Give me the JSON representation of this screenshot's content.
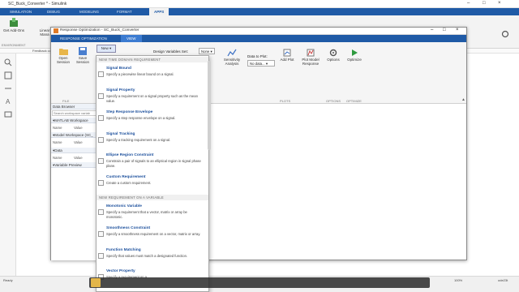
{
  "bg_window": {
    "title": "SC_Buck_Converter * - Simulink",
    "tabs": [
      "SIMULATION",
      "DEBUG",
      "MODELING",
      "FORMAT",
      "APPS"
    ],
    "active_tab": "APPS",
    "ribbon": {
      "get_addons": "Get Add-Ons",
      "linear_label": "Linear Mana",
      "environment": "ENVIRONMENT"
    },
    "address": "Feedback con"
  },
  "dialog": {
    "title": "Response Optimization - SC_Buck_Converter",
    "tabs": [
      "RESPONSE OPTIMIZATION",
      "VIEW"
    ],
    "active_tab": "VIEW",
    "ribbon": {
      "open_label": "Open Session",
      "save_label": "Save Session",
      "new_label": "New",
      "file_section": "FILE",
      "design_vars_label": "Design Variables Set:",
      "design_vars_value": "None",
      "sensitivity_label": "Sensitivity Analysis",
      "data_to_plot_label": "Data to Plot:",
      "data_to_plot_value": "No data...",
      "add_plot_label": "Add Plot",
      "plot_model_response_label": "Plot Model Response",
      "plots_section": "PLOTS",
      "options_label": "Options",
      "options_section": "OPTIONS",
      "optimize_label": "Optimize",
      "optimize_section": "OPTIMIZE"
    },
    "left_pane": {
      "data_browser": "Data Browser",
      "search_placeholder": "Search workspace variab",
      "matlab_workspace": "MATLAB Workspace",
      "model_workspace": "Model Workspace (SC_",
      "data": "Data",
      "variable_preview": "Variable Preview",
      "col_name": "Name",
      "col_value": "Value"
    }
  },
  "dropdown": {
    "section_time": "NEW TIME DOMAIN REQUIREMENT",
    "section_vars": "NEW REQUIREMENT ON A VARIABLE",
    "items_time": [
      {
        "title": "Signal Bound",
        "desc": "Specify a piecewise linear bound on a signal."
      },
      {
        "title": "Signal Property",
        "desc": "Specify a requirement on a signal property such as the mean value."
      },
      {
        "title": "Step Response Envelope",
        "desc": "Specify a step response envelope on a signal."
      },
      {
        "title": "Signal Tracking",
        "desc": "Specify a tracking requirement on a signal."
      },
      {
        "title": "Ellipse Region Constraint",
        "desc": "Constrain a pair of signals to an elliptical region in signal phase plane."
      },
      {
        "title": "Custom Requirement",
        "desc": "Create a custom requirement."
      }
    ],
    "items_vars": [
      {
        "title": "Monotonic Variable",
        "desc": "Specify a requirement that a vector, matrix or array be monotonic."
      },
      {
        "title": "Smoothness Constraint",
        "desc": "Specify a smoothness requirement on a vector, matrix or array."
      },
      {
        "title": "Function Matching",
        "desc": "Specify that values must match a designated function."
      },
      {
        "title": "Vector Property",
        "desc": "Specify a requirement on a"
      }
    ]
  },
  "status": {
    "zoom": "100%",
    "solver": "ode23t"
  }
}
